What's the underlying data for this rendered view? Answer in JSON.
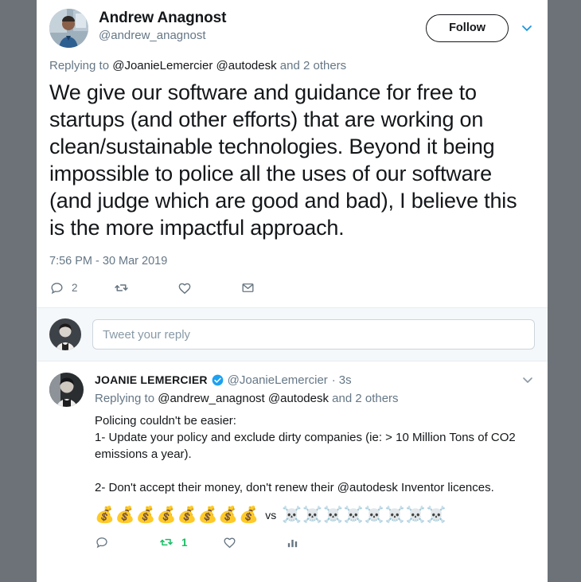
{
  "colors": {
    "background": "#6c7278",
    "card": "#ffffff",
    "link": "#1b95e0",
    "muted": "#657786",
    "text": "#14171a",
    "retweet_green": "#17bf63",
    "verified_blue": "#1da1f2",
    "composer_bg": "#f5f8fa",
    "border": "#e6ecf0"
  },
  "main_tweet": {
    "avatar": "andrew-anagnost-avatar",
    "display_name": "Andrew Anagnost",
    "handle": "@andrew_anagnost",
    "follow_label": "Follow",
    "caret_icon": "chevron-down-icon",
    "replying_prefix": "Replying to ",
    "replying_mentions": "@JoanieLemercier @autodesk",
    "replying_suffix": " and 2 others",
    "text": "We give our software and guidance for free to startups (and other efforts) that are working on clean/sustainable technologies. Beyond it being impossible to police all the uses of our software (and judge which are good and bad), I believe this is the more impactful approach.",
    "timestamp": "7:56 PM - 30 Mar 2019",
    "actions": {
      "reply_icon": "reply-icon",
      "reply_count": "2",
      "retweet_icon": "retweet-icon",
      "retweet_count": "",
      "like_icon": "heart-icon",
      "like_count": "",
      "dm_icon": "envelope-icon"
    }
  },
  "composer": {
    "avatar": "current-user-avatar",
    "placeholder": "Tweet your reply",
    "value": ""
  },
  "reply_tweet": {
    "avatar": "joanie-lemercier-avatar",
    "display_name": "JOANIE LEMERCIER",
    "verified_icon": "verified-badge-icon",
    "handle": "@JoanieLemercier",
    "time_ago": "3s",
    "separator": "·",
    "caret_icon": "chevron-down-icon",
    "replying_prefix": "Replying to ",
    "replying_mentions": "@andrew_anagnost @autodesk",
    "replying_suffix": " and 2 others",
    "text": "Policing couldn't be easier:\n1- Update your policy and exclude dirty companies (ie: > 10 Million Tons of CO2 emissions a year).\n\n2- Don't accept their money, don't renew their @autodesk Inventor licences.",
    "emoji_money": "💰💰💰💰💰💰💰💰",
    "emoji_vs": "vs",
    "emoji_skull": "☠️☠️☠️☠️☠️☠️☠️☠️",
    "actions": {
      "reply_icon": "reply-icon",
      "reply_count": "",
      "retweet_icon": "retweet-icon",
      "retweet_count": "1",
      "like_icon": "heart-icon",
      "like_count": "",
      "analytics_icon": "analytics-bar-chart-icon"
    }
  }
}
